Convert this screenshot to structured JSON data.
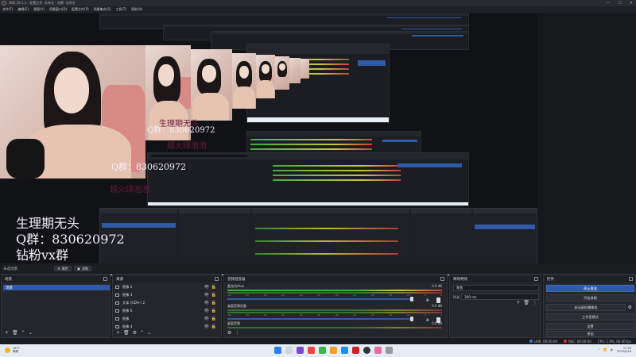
{
  "window": {
    "title": "OBS 29.1.3 - 配置文件: 未命名 - 场景: 未命名"
  },
  "menu": {
    "items": [
      "文件(F)",
      "编辑(E)",
      "视图(V)",
      "停靠窗口(D)",
      "配置文件(P)",
      "场景集合(S)",
      "工具(T)",
      "帮助(H)"
    ]
  },
  "overlay_text": {
    "line1": "生理期无头",
    "line2": "Q群：830620972",
    "line3": "钻粉vx群",
    "line4": "超火绿泡泡"
  },
  "scene_bar": {
    "label": "未选场景",
    "btn_props": "属性",
    "btn_filters": "滤镜"
  },
  "scenes": {
    "title": "场景",
    "items": [
      "场景"
    ]
  },
  "sources": {
    "title": "来源",
    "items": [
      "图像 2",
      "图像 3",
      "文本 (GDI+) 2",
      "图像 6",
      "图像",
      "图像 4"
    ]
  },
  "mixer": {
    "title": "音频混音器",
    "channels": [
      {
        "name": "麦克风/Aux",
        "db": "0.0 dB"
      },
      {
        "name": "桌面音频设备",
        "db": "0.0 dB"
      },
      {
        "name": "桌面音频",
        "db": "0.0 dB"
      }
    ],
    "ticks": [
      "-60",
      "-55",
      "-50",
      "-45",
      "-40",
      "-35",
      "-30",
      "-25",
      "-20",
      "-15",
      "-10",
      "-5",
      "0"
    ]
  },
  "transitions": {
    "title": "转场特效",
    "selected": "渐变",
    "duration_label": "时长",
    "duration": "300 ms"
  },
  "controls": {
    "title": "控件",
    "buttons": [
      "停止推流",
      "开始录制",
      "启动虚拟摄像机",
      "工作室模式",
      "设置",
      "退出"
    ]
  },
  "status": {
    "live": "LIVE: 00:00:00",
    "rec": "REC: 00:00:00",
    "cpu": "CPU: 1.9%, 60.00 fps"
  },
  "taskbar": {
    "weather_temp": "26°C",
    "weather_desc": "晴朗",
    "time": "17:33",
    "date": "2023/9/16"
  },
  "colors": {
    "accent": "#2f5aa8",
    "bg": "#1a1b1f",
    "panel": "#25262c",
    "overlay_pink": "#ff4f7a"
  }
}
